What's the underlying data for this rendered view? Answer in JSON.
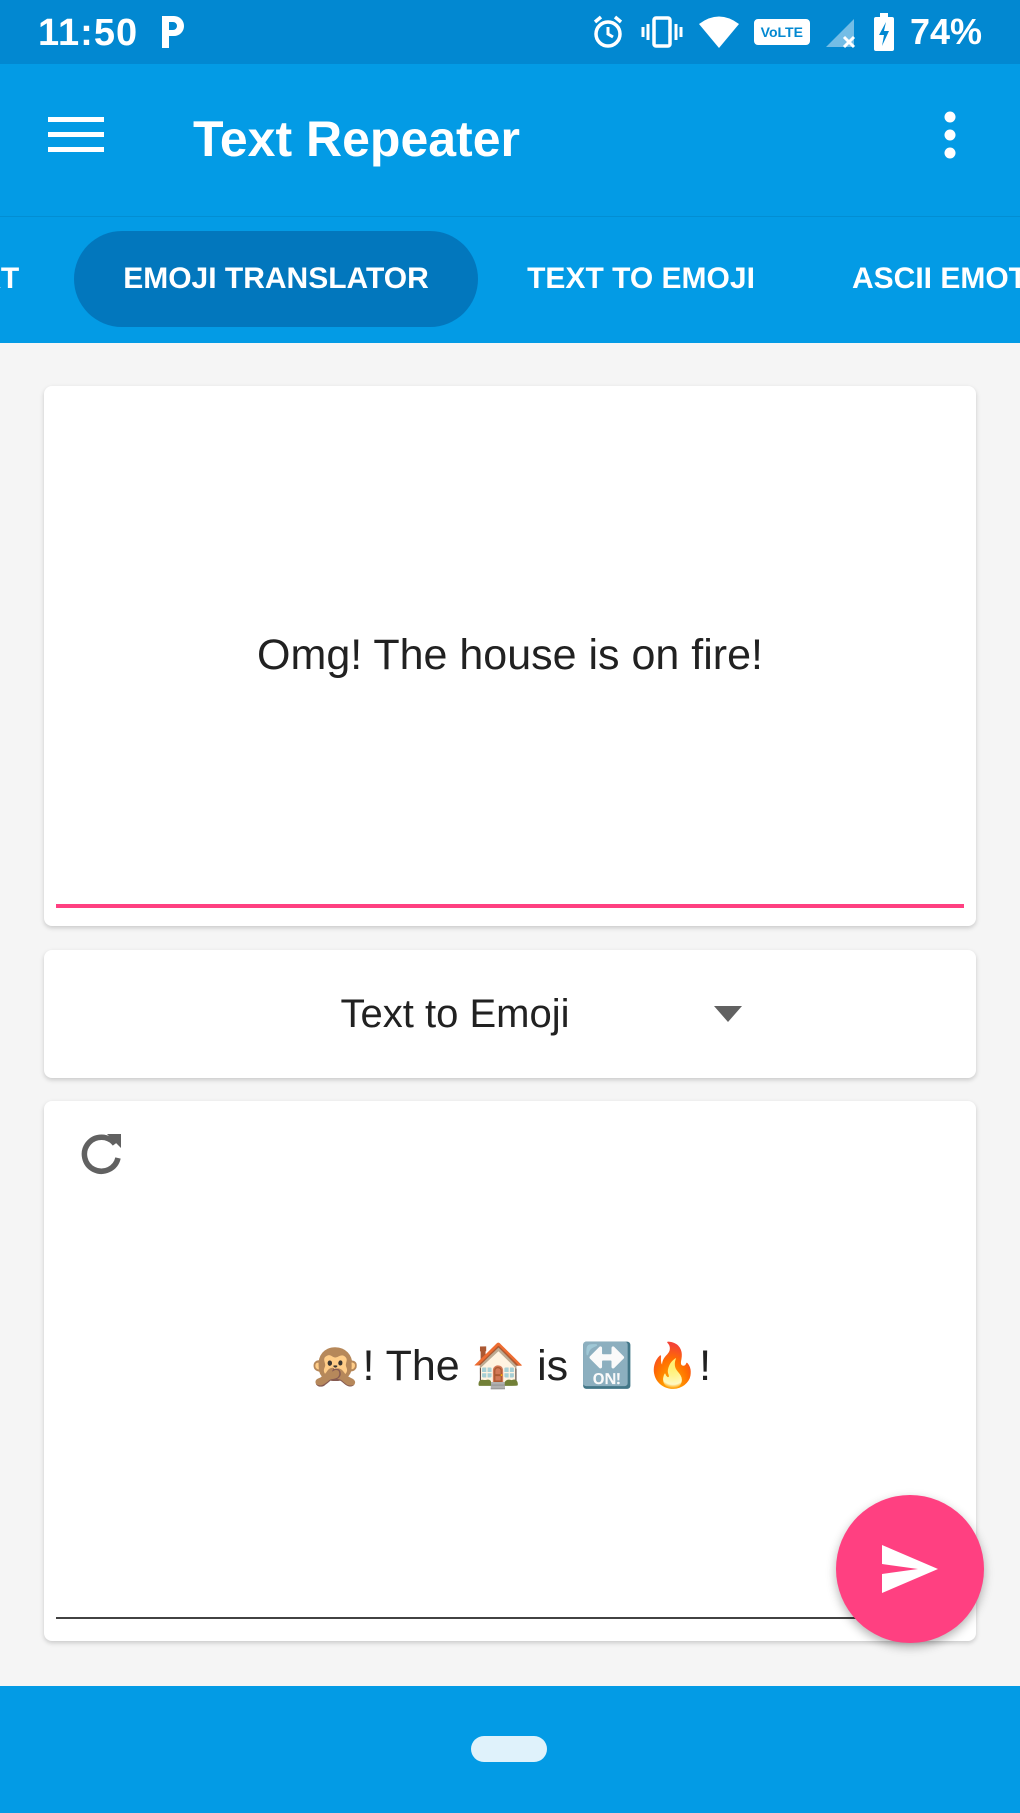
{
  "status_bar": {
    "time": "11:50",
    "network_badge": "VoLTE",
    "battery": "74%"
  },
  "app_bar": {
    "title": "Text Repeater"
  },
  "tabs": [
    {
      "label": "XT",
      "active": false
    },
    {
      "label": "EMOJI TRANSLATOR",
      "active": true
    },
    {
      "label": "TEXT TO EMOJI",
      "active": false
    },
    {
      "label": "ASCII EMOT",
      "active": false
    }
  ],
  "input": {
    "value": "Omg! The house is on fire!"
  },
  "mode_select": {
    "selected": "Text to Emoji"
  },
  "output": {
    "value": "🙊! The 🏠 is 🔛 🔥!"
  },
  "colors": {
    "status_bar": "#0288d1",
    "app_bar": "#039be5",
    "active_tab": "#0277bd",
    "accent": "#ff4081"
  },
  "icons": {
    "menu": "menu-icon",
    "more": "more-vert-icon",
    "refresh": "refresh-icon",
    "send": "send-icon",
    "dropdown": "arrow-drop-down-icon"
  }
}
